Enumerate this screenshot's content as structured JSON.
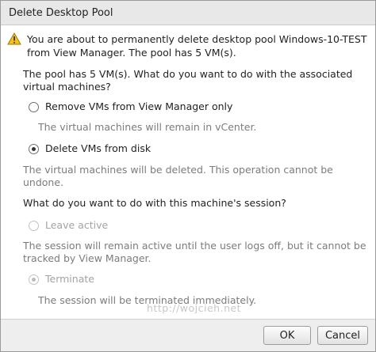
{
  "dialog": {
    "title": "Delete Desktop Pool",
    "warning_line1": "You are about to permanently delete desktop pool Windows-10-TEST",
    "warning_line2": "from View Manager. The pool has 5 VM(s).",
    "vm_question_line1": "The pool has 5 VM(s). What do you want to do with the associated",
    "vm_question_line2": "virtual machines?",
    "option_remove": {
      "label": "Remove VMs from View Manager only",
      "description": "The virtual machines will remain in vCenter.",
      "selected": false
    },
    "option_delete": {
      "label": "Delete VMs from disk",
      "description_line1": "The virtual machines will be deleted. This operation cannot be",
      "description_line2": "undone.",
      "selected": true
    },
    "session_question": "What do you want to do with this machine's session?",
    "option_leave_active": {
      "label": "Leave active",
      "description_line1": "The session will remain active until the user logs off, but it cannot be",
      "description_line2": "tracked by View Manager.",
      "selected": false,
      "enabled": false
    },
    "option_terminate": {
      "label": "Terminate",
      "description": "The session will be terminated immediately.",
      "selected": true,
      "enabled": false
    },
    "watermark": "http://wojcieh.net"
  },
  "buttons": {
    "ok": "OK",
    "cancel": "Cancel"
  },
  "colors": {
    "warning_icon": "#f4c21a"
  }
}
